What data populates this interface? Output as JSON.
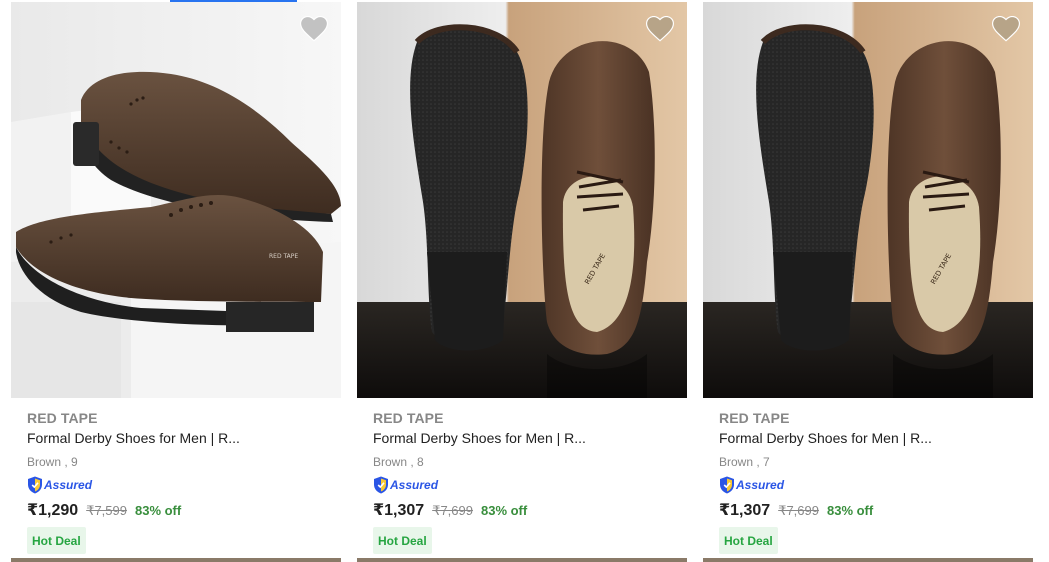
{
  "products": [
    {
      "brand": "RED TAPE",
      "title": "Formal Derby Shoes for Men | R...",
      "variant": "Brown , 9",
      "assured_label": "Assured",
      "price": "₹1,290",
      "mrp": "₹7,599",
      "discount": "83% off",
      "badge": "Hot Deal",
      "logo_text": "RED TAPE"
    },
    {
      "brand": "RED TAPE",
      "title": "Formal Derby Shoes for Men | R...",
      "variant": "Brown , 8",
      "assured_label": "Assured",
      "price": "₹1,307",
      "mrp": "₹7,699",
      "discount": "83% off",
      "badge": "Hot Deal",
      "logo_text": "RED TAPE"
    },
    {
      "brand": "RED TAPE",
      "title": "Formal Derby Shoes for Men | R...",
      "variant": "Brown , 7",
      "assured_label": "Assured",
      "price": "₹1,307",
      "mrp": "₹7,699",
      "discount": "83% off",
      "badge": "Hot Deal",
      "logo_text": "RED TAPE"
    }
  ],
  "icons": {
    "wishlist": "heart-icon",
    "assured": "assured-shield-icon"
  },
  "colors": {
    "accent": "#2874f0",
    "brand_text": "#878787",
    "discount": "#388e3c",
    "badge_bg": "#e8f6ea",
    "badge_text": "#26a541",
    "assured": "#2a55e5"
  }
}
